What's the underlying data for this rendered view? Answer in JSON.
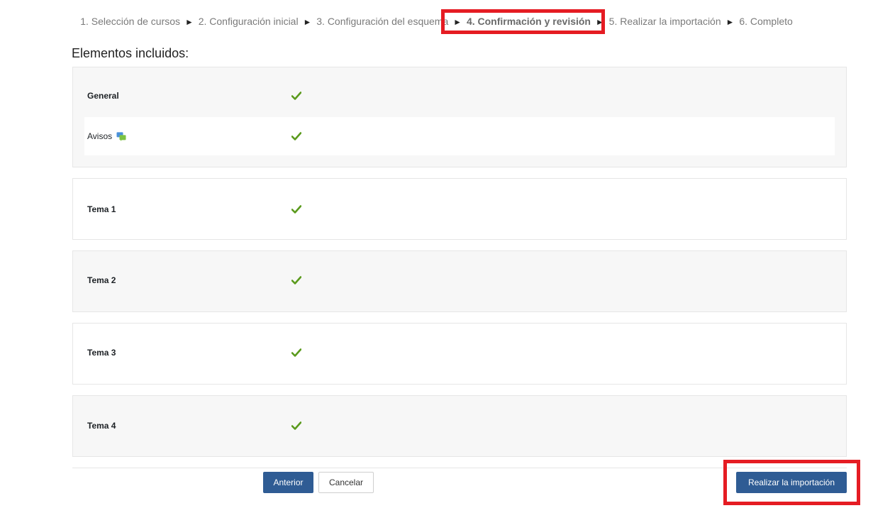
{
  "stepper": {
    "steps": [
      "1. Selección de cursos",
      "2. Configuración inicial",
      "3. Configuración del esquema",
      "4. Confirmación y revisión",
      "5. Realizar la importación",
      "6. Completo"
    ],
    "separator": "►",
    "current_index": 3
  },
  "section_title": "Elementos incluidos:",
  "sections": [
    {
      "label": "General",
      "included": true,
      "activities": [
        {
          "label": "Avisos",
          "icon": "forum-icon",
          "included": true
        }
      ]
    },
    {
      "label": "Tema 1",
      "included": true
    },
    {
      "label": "Tema 2",
      "included": true
    },
    {
      "label": "Tema 3",
      "included": true
    },
    {
      "label": "Tema 4",
      "included": true
    }
  ],
  "buttons": {
    "previous_label": "Anterior",
    "cancel_label": "Cancelar",
    "import_label": "Realizar la importación"
  },
  "colors": {
    "primary": "#2f5c94",
    "check": "#5a9a1c",
    "highlight": "#e51c23"
  }
}
